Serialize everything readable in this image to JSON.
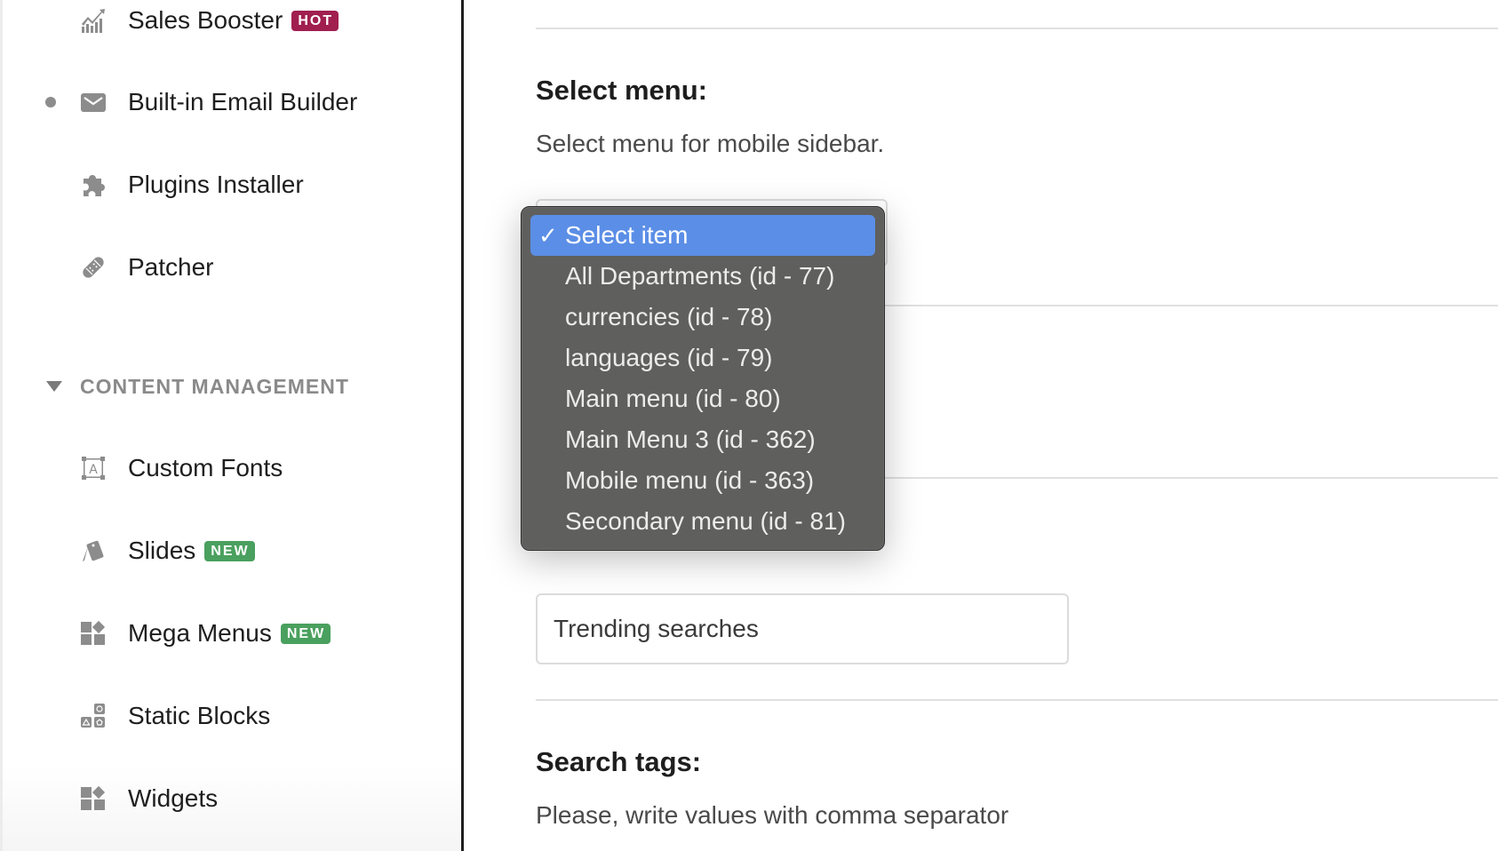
{
  "sidebar": {
    "items_top": [
      {
        "label": "Sales Booster",
        "icon": "chart-growth-icon",
        "badge": "HOT",
        "active": false
      },
      {
        "label": "Built-in Email Builder",
        "icon": "envelope-icon",
        "badge": null,
        "active": true
      },
      {
        "label": "Plugins Installer",
        "icon": "puzzle-icon",
        "badge": null,
        "active": false
      },
      {
        "label": "Patcher",
        "icon": "bandage-icon",
        "badge": null,
        "active": false
      }
    ],
    "section": {
      "title": "CONTENT MANAGEMENT",
      "expanded": true
    },
    "items_content": [
      {
        "label": "Custom Fonts",
        "icon": "font-icon",
        "badge": null
      },
      {
        "label": "Slides",
        "icon": "slides-icon",
        "badge": "NEW"
      },
      {
        "label": "Mega Menus",
        "icon": "widgets-icon",
        "badge": "NEW"
      },
      {
        "label": "Static Blocks",
        "icon": "blocks-icon",
        "badge": null
      },
      {
        "label": "Widgets",
        "icon": "widgets-icon",
        "badge": null
      }
    ]
  },
  "main": {
    "select_menu": {
      "title": "Select menu:",
      "description": "Select menu for mobile sidebar.",
      "selected": "Select item",
      "options": [
        "Select item",
        "All Departments (id - 77)",
        "currencies (id - 78)",
        "languages (id - 79)",
        "Main menu (id - 80)",
        "Main Menu 3 (id - 362)",
        "Mobile menu (id - 363)",
        "Secondary menu (id - 81)"
      ]
    },
    "trending_input": {
      "value": "Trending searches"
    },
    "search_tags": {
      "title": "Search tags:",
      "description": "Please, write values with comma separator"
    }
  },
  "colors": {
    "hot_badge": "#a01f4f",
    "new_badge": "#4aa05e",
    "dropdown_bg": "#5f5f5e",
    "dropdown_selected": "#5b8ee6",
    "icon_gray": "#8c8c8c"
  }
}
